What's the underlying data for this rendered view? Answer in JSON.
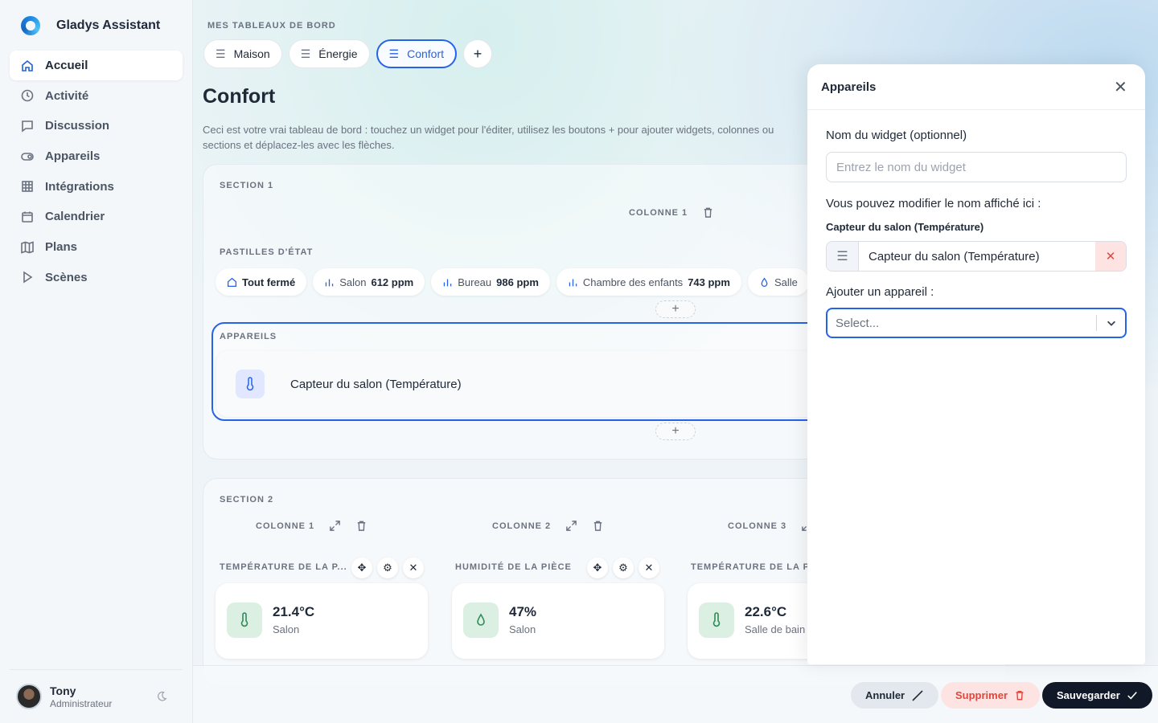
{
  "app": {
    "name": "Gladys Assistant"
  },
  "sidebar": {
    "items": [
      {
        "label": "Accueil",
        "icon": "home-icon"
      },
      {
        "label": "Activité",
        "icon": "clock-icon"
      },
      {
        "label": "Discussion",
        "icon": "chat-icon"
      },
      {
        "label": "Appareils",
        "icon": "toggle-icon"
      },
      {
        "label": "Intégrations",
        "icon": "grid-icon"
      },
      {
        "label": "Calendrier",
        "icon": "calendar-icon"
      },
      {
        "label": "Plans",
        "icon": "map-icon"
      },
      {
        "label": "Scènes",
        "icon": "play-icon"
      }
    ],
    "user": {
      "name": "Tony",
      "role": "Administrateur"
    }
  },
  "dashboard": {
    "label": "MES TABLEAUX DE BORD",
    "tabs": [
      {
        "label": "Maison"
      },
      {
        "label": "Énergie"
      },
      {
        "label": "Confort"
      }
    ],
    "add_tab": "+",
    "title": "Confort",
    "description": "Ceci est votre vrai tableau de bord : touchez un widget pour l'éditer, utilisez les boutons + pour ajouter widgets, colonnes ou sections et déplacez-les avec les flèches."
  },
  "section1": {
    "title": "SECTION 1",
    "column": "COLONNE 1",
    "status_label": "PASTILLES D'ÉTAT",
    "pills": [
      {
        "name": "Tout fermé",
        "value": ""
      },
      {
        "name": "Salon",
        "value": "612 ppm"
      },
      {
        "name": "Bureau",
        "value": "986 ppm"
      },
      {
        "name": "Chambre des enfants",
        "value": "743 ppm"
      },
      {
        "name": "Salle",
        "value": ""
      }
    ],
    "devices_label": "APPAREILS",
    "device_name": "Capteur du salon (Température)",
    "add": "+"
  },
  "section2": {
    "title": "SECTION 2",
    "columns": [
      {
        "label": "COLONNE 1",
        "widget_label": "TEMPÉRATURE DE LA P...",
        "value": "21.4°C",
        "location": "Salon"
      },
      {
        "label": "COLONNE 2",
        "widget_label": "HUMIDITÉ DE LA PIÈCE",
        "value": "47%",
        "location": "Salon"
      },
      {
        "label": "COLONNE 3",
        "widget_label": "TEMPÉRATURE DE LA P",
        "value": "22.6°C",
        "location": "Salle de bain"
      }
    ]
  },
  "actions": {
    "cancel": "Annuler",
    "delete": "Supprimer",
    "save": "Sauvegarder"
  },
  "modal": {
    "title": "Appareils",
    "name_label": "Nom du widget (optionnel)",
    "name_placeholder": "Entrez le nom du widget",
    "rename_label": "Vous pouvez modifier le nom affiché ici :",
    "device_title": "Capteur du salon (Température)",
    "device_value": "Capteur du salon (Température)",
    "add_label": "Ajouter un appareil :",
    "select_placeholder": "Select..."
  },
  "colors": {
    "accent": "#2563eb",
    "danger": "#e0463b",
    "dark": "#111827"
  }
}
